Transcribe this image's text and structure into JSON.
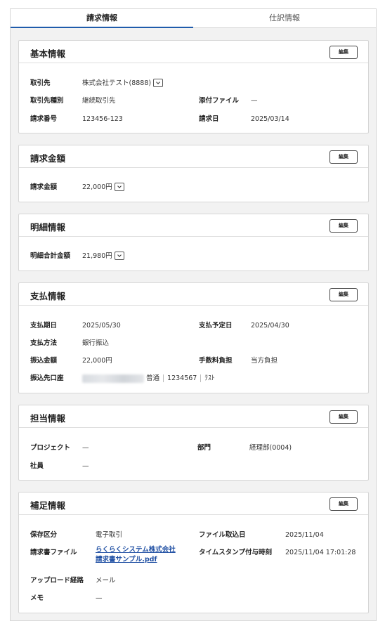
{
  "tabs": [
    {
      "label": "請求情報",
      "active": true
    },
    {
      "label": "仕訳情報",
      "active": false
    }
  ],
  "edit_label": "編集",
  "basic": {
    "title": "基本情報",
    "partner_label": "取引先",
    "partner_value": "株式会社テスト(8888)",
    "partner_type_label": "取引先種別",
    "partner_type_value": "継続取引先",
    "attachment_label": "添付ファイル",
    "attachment_value": "—",
    "invoice_no_label": "請求番号",
    "invoice_no_value": "123456-123",
    "invoice_date_label": "請求日",
    "invoice_date_value": "2025/03/14"
  },
  "amount": {
    "title": "請求金額",
    "label": "請求金額",
    "value": "22,000円"
  },
  "detail": {
    "title": "明細情報",
    "label": "明細合計金額",
    "value": "21,980円"
  },
  "payment": {
    "title": "支払情報",
    "due_label": "支払期日",
    "due_value": "2025/05/30",
    "scheduled_label": "支払予定日",
    "scheduled_value": "2025/04/30",
    "method_label": "支払方法",
    "method_value": "銀行振込",
    "transfer_amount_label": "振込金額",
    "transfer_amount_value": "22,000円",
    "fee_label": "手数料負担",
    "fee_value": "当方負担",
    "account_label": "振込先口座",
    "account_type": "普通",
    "account_number": "1234567",
    "account_holder": "ﾃｽﾄ"
  },
  "staff": {
    "title": "担当情報",
    "project_label": "プロジェクト",
    "project_value": "—",
    "dept_label": "部門",
    "dept_value": "経理部(0004)",
    "employee_label": "社員",
    "employee_value": "—"
  },
  "supplement": {
    "title": "補足情報",
    "storage_label": "保存区分",
    "storage_value": "電子取引",
    "import_date_label": "ファイル取込日",
    "import_date_value": "2025/11/04",
    "file_label": "請求書ファイル",
    "file_link_line1": "らくらくシステム株式会社",
    "file_link_line2": "請求書サンプル.pdf",
    "timestamp_label": "タイムスタンプ付与時刻",
    "timestamp_value": "2025/11/04 17:01:28",
    "upload_label": "アップロード経路",
    "upload_value": "メール",
    "memo_label": "メモ",
    "memo_value": "—"
  }
}
